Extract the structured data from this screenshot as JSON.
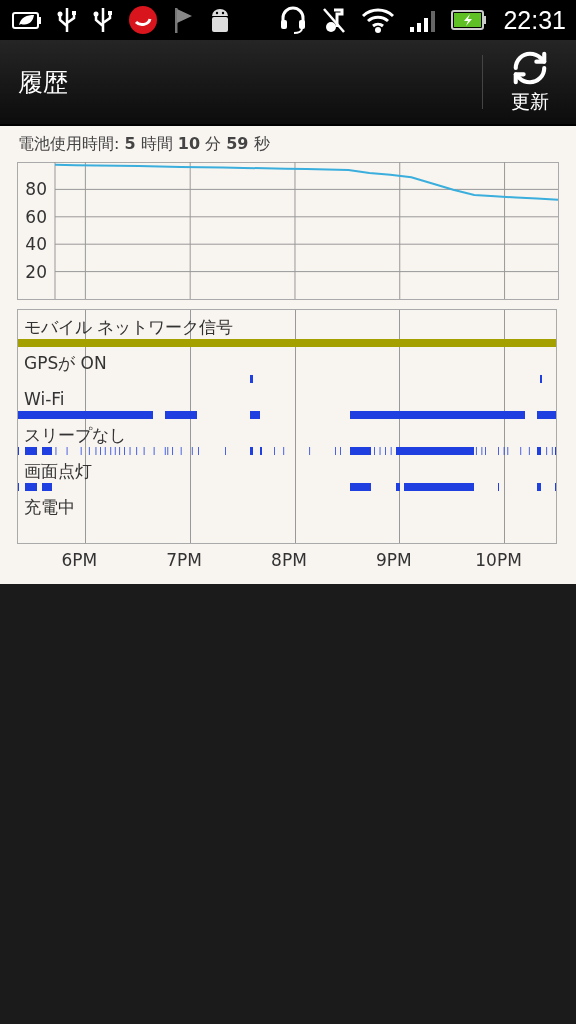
{
  "status_bar": {
    "time": "22:31"
  },
  "action_bar": {
    "title": "履歴",
    "refresh_button": {
      "label": "更新"
    }
  },
  "battery": {
    "summary": "電池使用時間: **5** 時間 **10** 分 **59** 秒",
    "chart_data": {
      "type": "line",
      "categories": [
        null,
        null,
        null,
        null,
        null,
        null,
        null,
        null,
        null,
        null,
        null,
        null,
        null,
        null,
        null,
        null,
        null,
        null,
        null,
        null,
        null,
        null,
        null,
        null,
        null
      ],
      "series": [
        {
          "color": "#3aaedc",
          "values": [
            98,
            97.7,
            97.5,
            97.2,
            97,
            96.7,
            96.4,
            96.2,
            95.9,
            95.7,
            95.4,
            95.1,
            94.8,
            94.5,
            94.1,
            91.9,
            90.7,
            88.8,
            84.3,
            79.8,
            76,
            75,
            74.1,
            73.3,
            72.5
          ]
        }
      ],
      "ylim": [
        0,
        100
      ],
      "grid": true,
      "yticks": [
        {
          "value": 20,
          "label": "20"
        },
        {
          "value": 40,
          "label": "40"
        },
        {
          "value": 60,
          "label": "60"
        },
        {
          "value": 80,
          "label": "80"
        }
      ]
    }
  },
  "signals": {
    "rows": [
      {
        "label": "モバイル ネットワーク信号",
        "kind": "mobile"
      },
      {
        "label": "GPSが ON",
        "kind": "gps"
      },
      {
        "label": "Wi-Fi",
        "kind": "wifi"
      },
      {
        "label": "スリープなし",
        "kind": "awake"
      },
      {
        "label": "画面点灯",
        "kind": "screen"
      },
      {
        "label": "充電中",
        "kind": "charging"
      }
    ],
    "time_labels": [
      "6PM",
      "7PM",
      "8PM",
      "9PM",
      "10PM"
    ]
  }
}
